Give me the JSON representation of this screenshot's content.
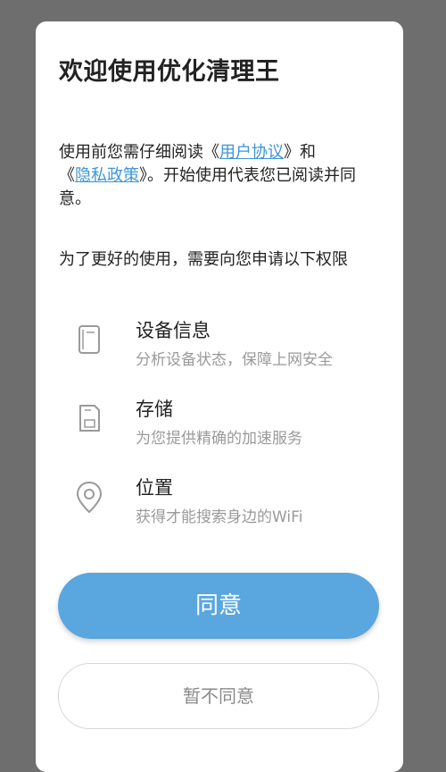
{
  "dialog": {
    "title": "欢迎使用优化清理王",
    "intro": {
      "line1_prefix": "使用前您需仔细阅读《",
      "user_agreement_link": "用户协议",
      "line1_suffix": "》和",
      "line2_prefix": "《",
      "privacy_policy_link": "隐私政策",
      "line2_suffix": "》。开始使用代表您已阅读并同意。"
    },
    "permissions_header": "为了更好的使用，需要向您申请以下权限",
    "permissions": [
      {
        "name": "设备信息",
        "description": "分析设备状态，保障上网安全",
        "icon": "device-info-icon"
      },
      {
        "name": "存储",
        "description": "为您提供精确的加速服务",
        "icon": "storage-icon"
      },
      {
        "name": "位置",
        "description": "获得才能搜索身边的WiFi",
        "icon": "location-pin-icon"
      }
    ],
    "agree_button": "同意",
    "disagree_button": "暂不同意"
  },
  "colors": {
    "accent": "#5aa6de",
    "link": "#3d95d8",
    "overlay": "#6e6e6e"
  }
}
